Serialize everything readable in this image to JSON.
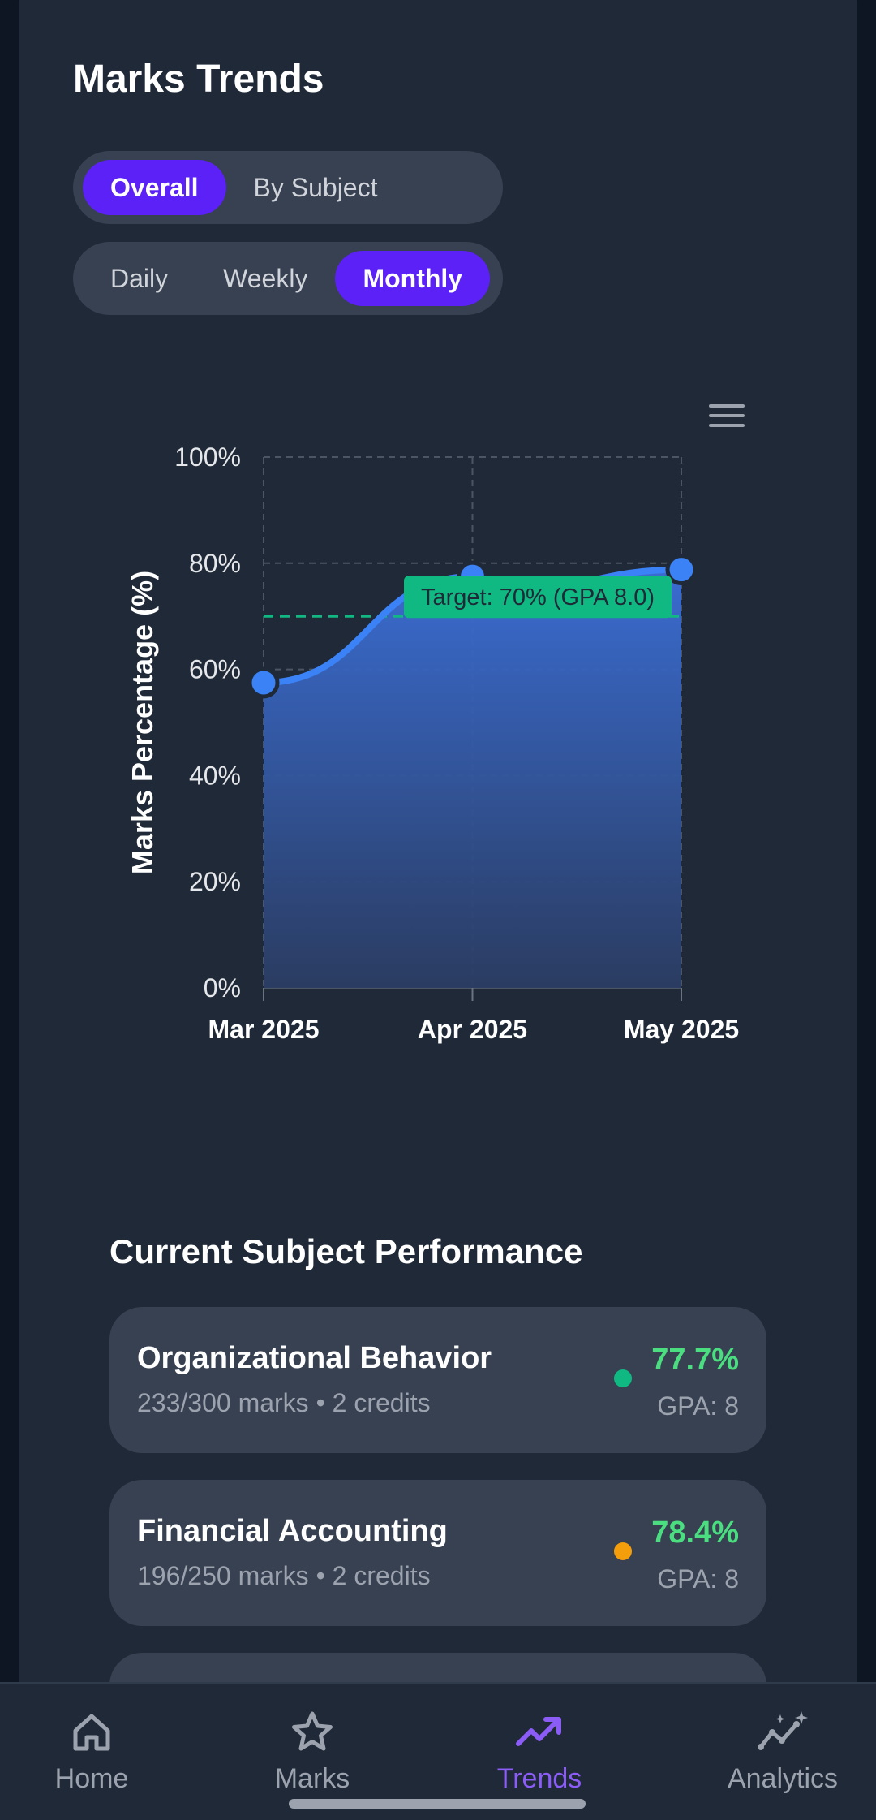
{
  "header": {
    "title": "Marks Trends"
  },
  "view_toggle": {
    "options": [
      "Overall",
      "By Subject"
    ],
    "active": "Overall"
  },
  "period_toggle": {
    "options": [
      "Daily",
      "Weekly",
      "Monthly"
    ],
    "active": "Monthly"
  },
  "chart_menu_icon": "hamburger-menu-icon",
  "chart_data": {
    "type": "area",
    "x": [
      "Mar 2025",
      "Apr 2025",
      "May 2025"
    ],
    "series": [
      {
        "values": [
          57.5,
          77.5,
          78.8
        ],
        "color": "#3b82f6"
      }
    ],
    "ylabel": "Marks Percentage (%)",
    "ylim": [
      0,
      100
    ],
    "yticks": [
      0,
      20,
      40,
      60,
      80,
      100
    ],
    "ytick_labels": [
      "0%",
      "20%",
      "40%",
      "60%",
      "80%",
      "100%"
    ],
    "grid": true,
    "target": {
      "value": 70,
      "label": "Target: 70% (GPA 8.0)",
      "color": "#10b981"
    }
  },
  "performance": {
    "title": "Current Subject Performance",
    "subjects": [
      {
        "name": "Organizational Behavior",
        "meta": "233/300 marks • 2 credits",
        "percent": "77.7%",
        "gpa": "GPA: 8",
        "dot_color": "#10b981"
      },
      {
        "name": "Financial Accounting",
        "meta": "196/250 marks • 2 credits",
        "percent": "78.4%",
        "gpa": "GPA: 8",
        "dot_color": "#f59e0b"
      }
    ]
  },
  "nav": {
    "items": [
      {
        "label": "Home",
        "icon": "home-icon"
      },
      {
        "label": "Marks",
        "icon": "star-icon"
      },
      {
        "label": "Trends",
        "icon": "trending-up-icon"
      },
      {
        "label": "Analytics",
        "icon": "analytics-sparkle-icon"
      }
    ],
    "active": "Trends",
    "active_color": "#8b5cf6"
  }
}
